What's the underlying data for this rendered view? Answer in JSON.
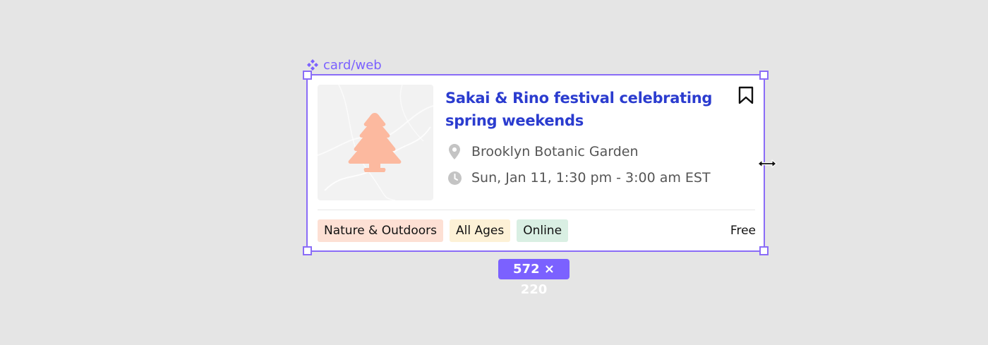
{
  "canvas": {
    "component_name": "card/web",
    "component_icon": "component-icon",
    "size_badge": "572 × 220",
    "accent_color": "#7b61ff"
  },
  "card": {
    "title": "Sakai & Rino festival celebrating spring weekends",
    "location": "Brooklyn Botanic Garden",
    "datetime": "Sun, Jan 11, 1:30 pm - 3:00 am EST",
    "price": "Free",
    "image_icon": "tree-icon",
    "tags": [
      {
        "label": "Nature & Outdoors",
        "color": "#fde0d4"
      },
      {
        "label": "All Ages",
        "color": "#fdf1d6"
      },
      {
        "label": "Online",
        "color": "#d9efe3"
      }
    ],
    "colors": {
      "title": "#2b3ccf",
      "tree": "#fcb99f"
    }
  }
}
